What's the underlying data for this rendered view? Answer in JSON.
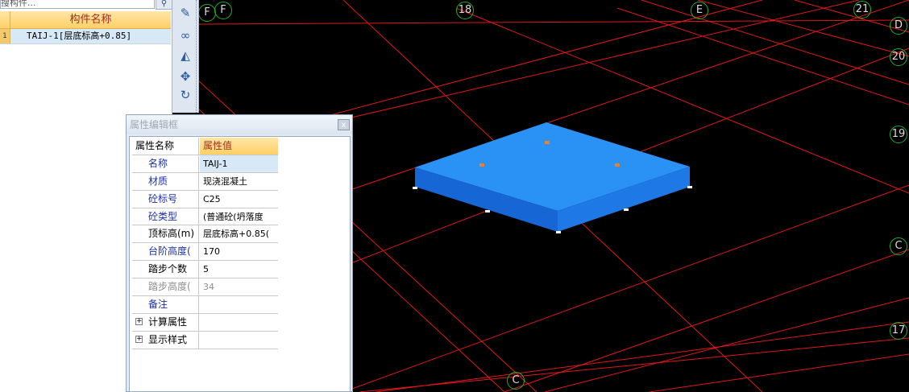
{
  "component_list": {
    "search_placeholder": "搜构件...",
    "search_icon": "search-icon",
    "header_title": "构件名称",
    "rows": [
      {
        "num": "1",
        "name": "TAIJ-1[层底标高+0.85]"
      }
    ]
  },
  "toolbar": {
    "buttons": [
      {
        "icon": "brush-icon",
        "glyph": "✎"
      },
      {
        "icon": "link-icon",
        "glyph": "∞"
      },
      {
        "icon": "mirror-icon",
        "glyph": "◭"
      },
      {
        "icon": "move-icon",
        "glyph": "✥"
      },
      {
        "icon": "rotate-icon",
        "glyph": "↻"
      }
    ]
  },
  "property_dialog": {
    "title": "属性编辑框",
    "close_glyph": "x",
    "header": {
      "name": "属性名称",
      "value": "属性值"
    },
    "rows": [
      {
        "name": "名称",
        "value": "TAIJ-1",
        "style": "blue",
        "selected": true
      },
      {
        "name": "材质",
        "value": "现浇混凝土",
        "style": "blue"
      },
      {
        "name": "砼标号",
        "value": "C25",
        "style": "blue"
      },
      {
        "name": "砼类型",
        "value": "(普通砼(坍落度",
        "style": "blue"
      },
      {
        "name": "顶标高(m)",
        "value": "层底标高+0.85(",
        "style": "black"
      },
      {
        "name": "台阶高度(",
        "value": "170",
        "style": "blue"
      },
      {
        "name": "踏步个数",
        "value": "5",
        "style": "black"
      },
      {
        "name": "踏步高度(",
        "value": "34",
        "style": "gray"
      },
      {
        "name": "备注",
        "value": "",
        "style": "blue"
      }
    ],
    "groups": [
      {
        "name": "计算属性",
        "expander": "+"
      },
      {
        "name": "显示样式",
        "expander": "+"
      }
    ]
  },
  "viewport": {
    "grid_color": "#e01818",
    "slab_top_color": "#1e88f0",
    "slab_side_color": "#1565d8",
    "axis_labels": [
      {
        "label": "F"
      },
      {
        "label": "F"
      },
      {
        "label": "18"
      },
      {
        "label": "E"
      },
      {
        "label": "21"
      },
      {
        "label": "D"
      },
      {
        "label": "20"
      },
      {
        "label": "19"
      },
      {
        "label": "C"
      },
      {
        "label": "17"
      },
      {
        "label": "C"
      }
    ]
  }
}
